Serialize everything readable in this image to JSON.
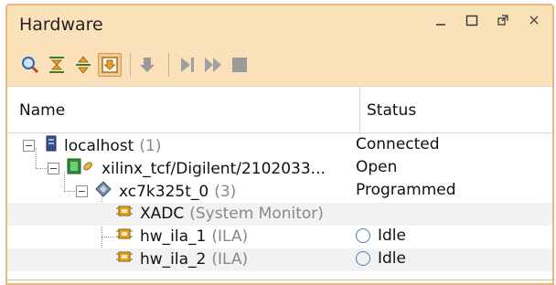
{
  "window": {
    "title": "Hardware",
    "controls": [
      "minimize-icon",
      "maximize-icon",
      "restore-icon",
      "close-icon"
    ]
  },
  "toolbar": {
    "buttons": [
      "search-icon",
      "collapse-all-icon",
      "expand-all-icon",
      "auto-connect-icon",
      "program-device-icon",
      "run-trigger-icon",
      "run-trigger-immediate-icon",
      "stop-trigger-icon"
    ]
  },
  "table": {
    "columns": {
      "name": "Name",
      "status": "Status"
    },
    "rows": [
      {
        "name": "localhost",
        "sub": "(1)",
        "status": "Connected",
        "icon": "server-icon"
      },
      {
        "name": "xilinx_tcf/Digilent/2102033...",
        "sub": "",
        "status": "Open",
        "icon": "jtag-target-icon"
      },
      {
        "name": "xc7k325t_0",
        "sub": "(3)",
        "status": "Programmed",
        "icon": "fpga-device-icon"
      },
      {
        "name": "XADC",
        "sub": "(System Monitor)",
        "status": "",
        "icon": "debug-core-icon"
      },
      {
        "name": "hw_ila_1",
        "sub": "(ILA)",
        "status": "Idle",
        "icon": "debug-core-icon"
      },
      {
        "name": "hw_ila_2",
        "sub": "(ILA)",
        "status": "Idle",
        "icon": "debug-core-icon"
      }
    ]
  },
  "colors": {
    "titlebar_bg": "#fbe1ba",
    "border": "#e8b784",
    "idle_blue": "#4a7fc4"
  }
}
